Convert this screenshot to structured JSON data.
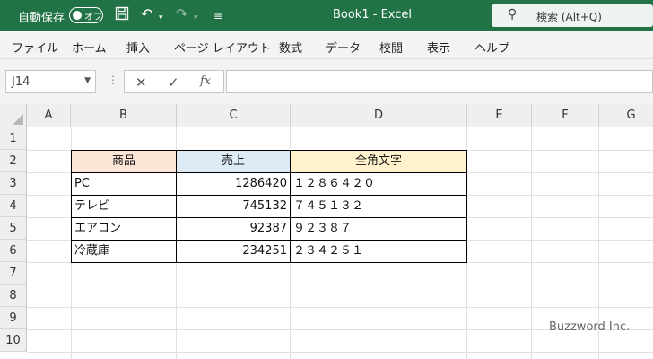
{
  "titlebar": {
    "autosave_label": "自動保存",
    "autosave_state": "オフ",
    "doc_title": "Book1  -  Excel",
    "search_placeholder": "検索 (Alt+Q)",
    "color": "#217346"
  },
  "ribbon": {
    "tabs": [
      "ファイル",
      "ホーム",
      "挿入",
      "ページ レイアウト",
      "数式",
      "データ",
      "校閲",
      "表示",
      "ヘルプ"
    ]
  },
  "formula_bar": {
    "name_box": "J14",
    "fx_label": "fx",
    "formula": ""
  },
  "grid": {
    "columns": [
      "A",
      "B",
      "C",
      "D",
      "E",
      "F",
      "G"
    ],
    "rows": [
      "1",
      "2",
      "3",
      "4",
      "5",
      "6",
      "7",
      "8",
      "9",
      "10"
    ],
    "table": {
      "headers": [
        "商品",
        "売上",
        "全角文字"
      ],
      "header_colors": [
        "#fce4d6",
        "#ddebf7",
        "#fff2cc"
      ],
      "rows": [
        [
          "PC",
          "1286420",
          "１２８６４２０"
        ],
        [
          "テレビ",
          "745132",
          "７４５１３２"
        ],
        [
          "エアコン",
          "92387",
          "９２３８７"
        ],
        [
          "冷蔵庫",
          "234251",
          "２３４２５１"
        ]
      ]
    }
  },
  "watermark": "Buzzword Inc."
}
